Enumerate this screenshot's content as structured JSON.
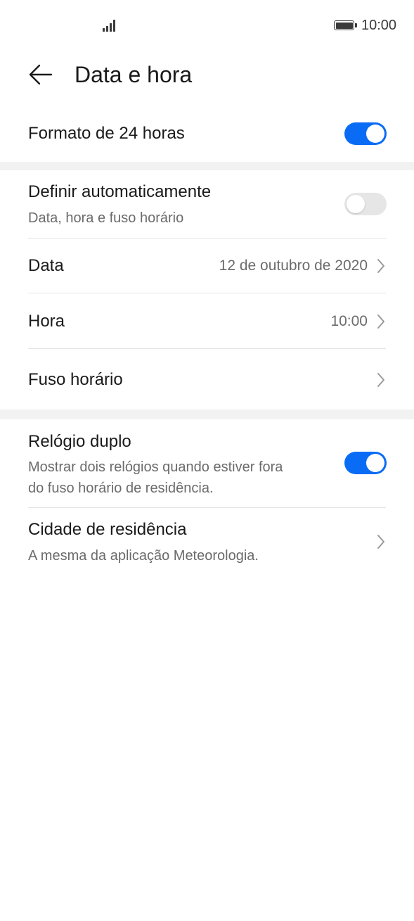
{
  "status_bar": {
    "time": "10:00",
    "signal_icon": "signal-bars-icon",
    "battery_icon": "battery-full-icon"
  },
  "header": {
    "title": "Data e hora",
    "back_icon": "arrow-left-icon"
  },
  "settings": {
    "format_24h": {
      "title": "Formato de 24 horas",
      "toggle_state": "on"
    },
    "auto_set": {
      "title": "Definir automaticamente",
      "subtitle": "Data, hora e fuso horário",
      "toggle_state": "off"
    },
    "date": {
      "title": "Data",
      "value": "12 de outubro de 2020"
    },
    "time": {
      "title": "Hora",
      "value": "10:00"
    },
    "timezone": {
      "title": "Fuso horário"
    },
    "dual_clock": {
      "title": "Relógio duplo",
      "subtitle_line1": "Mostrar dois relógios quando estiver fora",
      "subtitle_line2": "do fuso horário de residência.",
      "toggle_state": "on"
    },
    "home_city": {
      "title": "Cidade de residência",
      "subtitle": "A mesma da aplicação Meteorologia."
    }
  },
  "colors": {
    "accent": "#0a6cf5",
    "toggle_off": "#e6e6e6",
    "section_gap": "#f2f2f2",
    "secondary_text": "#6b6b6b"
  }
}
